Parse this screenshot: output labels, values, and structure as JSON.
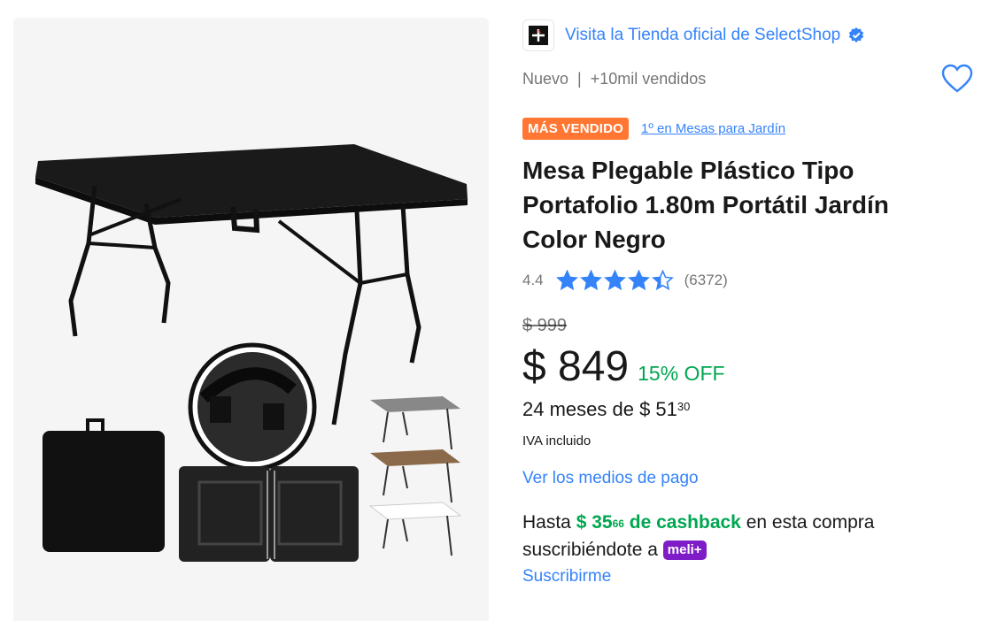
{
  "store": {
    "label": "Visita la Tienda oficial de SelectShop"
  },
  "condition": {
    "status": "Nuevo",
    "separator": "|",
    "sold": "+10mil vendidos"
  },
  "badge": {
    "label": "MÁS VENDIDO",
    "rank": "1º en Mesas para Jardín"
  },
  "product": {
    "title": "Mesa Plegable Plástico Tipo Portafolio 1.80m Portátil Jardín Color Negro"
  },
  "rating": {
    "score": "4.4",
    "stars": 4.4,
    "count": "(6372)"
  },
  "pricing": {
    "original": "$ 999",
    "current": "$ 849",
    "discount": "15% OFF",
    "installments_prefix": "24 meses de $ 51",
    "installments_cents": "30",
    "tax": "IVA incluido"
  },
  "links": {
    "payment_methods": "Ver los medios de pago",
    "subscribe": "Suscribirme"
  },
  "cashback": {
    "prefix": "Hasta",
    "amount": "$ 35",
    "cents": "66",
    "middle": "de cashback",
    "suffix": "en esta compra suscribiéndote a",
    "program": "meli+"
  },
  "colors": {
    "accent_blue": "#3483fa",
    "green": "#00a650",
    "badge_orange": "#ff7733",
    "meli_purple": "#7e1dc7"
  },
  "icons": {
    "verified": "verified-check-icon",
    "favorite": "heart-icon",
    "store_logo": "selectshop-logo-icon",
    "star": "star-icon"
  }
}
